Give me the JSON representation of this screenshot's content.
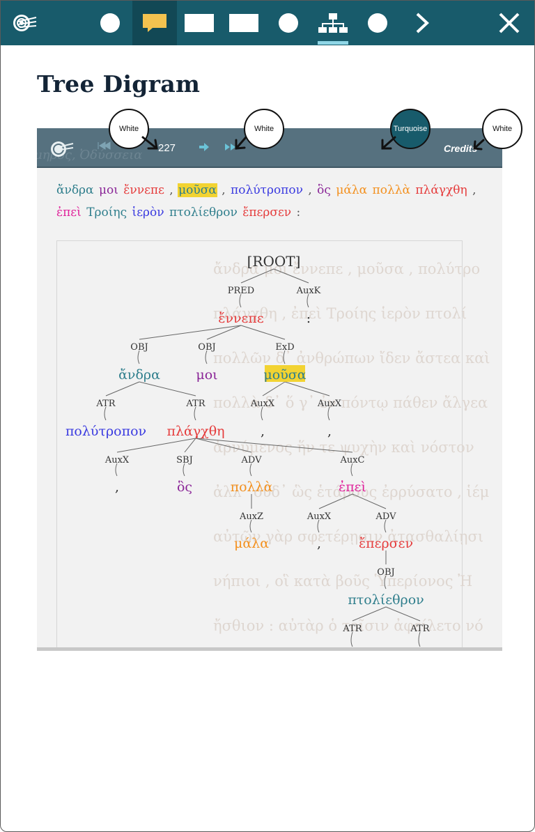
{
  "toolbar": {
    "items": [
      {
        "icon": "logo-icon"
      },
      {
        "icon": "circle-icon"
      },
      {
        "icon": "speech-bubble-icon"
      },
      {
        "icon": "rectangle-icon"
      },
      {
        "icon": "rectangle-icon"
      },
      {
        "icon": "circle-icon"
      },
      {
        "icon": "tree-diagram-icon"
      },
      {
        "icon": "circle-icon"
      },
      {
        "icon": "chevron-right-icon"
      },
      {
        "icon": "close-icon"
      }
    ],
    "colors": {
      "bar": "#185b6b",
      "active": "#124855",
      "accent": "#f4c24f"
    }
  },
  "page": {
    "title": "Tree Digram"
  },
  "screenshot": {
    "header": {
      "ghost_title": "μηρος, Ὀδύσσεια",
      "page_number": "227",
      "credits": "Credits"
    },
    "sentence": [
      {
        "text": "ἄνδρα",
        "color": "#2f7e8c"
      },
      {
        "text": "μοι",
        "color": "#8a2597"
      },
      {
        "text": "ἔννεπε",
        "color": "#e53b3b"
      },
      {
        "text": ",",
        "color": "#555555"
      },
      {
        "text": "μοῦσα",
        "color": "#2f7e8c",
        "highlight": true
      },
      {
        "text": ",",
        "color": "#555555"
      },
      {
        "text": "πολύτροπον",
        "color": "#3a3ae0"
      },
      {
        "text": ",",
        "color": "#555555"
      },
      {
        "text": "ὃς",
        "color": "#8a2597"
      },
      {
        "text": "μάλα",
        "color": "#f3901e"
      },
      {
        "text": "πολλὰ",
        "color": "#f3901e"
      },
      {
        "text": "πλάγχθη",
        "color": "#e53b3b"
      },
      {
        "text": ",",
        "color": "#555555"
      },
      {
        "text": "ἐπεὶ",
        "color": "#e0209a"
      },
      {
        "text": "Τροίης",
        "color": "#2f7e8c"
      },
      {
        "text": "ἱερὸν",
        "color": "#3a3ae0"
      },
      {
        "text": "πτολίεθρον",
        "color": "#2f7e8c"
      },
      {
        "text": "ἔπερσεν",
        "color": "#e53b3b"
      },
      {
        "text": ":",
        "color": "#555555"
      }
    ],
    "background_lines": [
      "ἄνδρα μοι ἔννεπε , μοῦσα , πολύτρο",
      "πλάγχθη , ἐπεὶ Τροίης ἱερὸν πτολί",
      "πολλῶν δ᾽ ἀνθρώπων ἴδεν ἄστεα καὶ",
      "πολλὰ δ᾽ ὅ γ᾽ ἐν πόντῳ πάθεν ἄλγεα",
      "ἀρνύμενος ἥν τε ψυχὴν καὶ νόστον",
      "ἀλλ᾽ οὐδ᾽ ὣς ἑτάρους ἐρρύσατο , ἱέμ",
      "αὐτῶν γὰρ σφετέρῃσιν ἀτασθαλίῃσι",
      "νήπιοι , οἳ κατὰ βοῦς Ὑπερίονος Ἠ",
      "ἤσθιον : αὐτὰρ ὁ τοῖσιν ἀφείλετο νό"
    ],
    "tree": {
      "root": "[ROOT]",
      "nodes": {
        "enn": {
          "word": "ἔννεπε",
          "color": "#e53b3b",
          "rel": "PRED"
        },
        "colon": {
          "word": ":",
          "color": "#333333",
          "rel": "AuxK"
        },
        "andra": {
          "word": "ἄνδρα",
          "color": "#2f7e8c",
          "rel": "OBJ"
        },
        "moi": {
          "word": "μοι",
          "color": "#8a2597",
          "rel": "OBJ"
        },
        "mousa": {
          "word": "μοῦσα",
          "color": "#2f7e8c",
          "rel": "ExD",
          "highlight": true
        },
        "poly": {
          "word": "πολύτροπον",
          "color": "#3a3ae0",
          "rel": "ATR"
        },
        "plag": {
          "word": "πλάγχθη",
          "color": "#e53b3b",
          "rel": "ATR"
        },
        "c1": {
          "word": ",",
          "color": "#333333",
          "rel": "AuxX"
        },
        "c2": {
          "word": ",",
          "color": "#333333",
          "rel": "AuxX"
        },
        "c3": {
          "word": ",",
          "color": "#333333",
          "rel": "AuxX"
        },
        "hos": {
          "word": "ὃς",
          "color": "#8a2597",
          "rel": "SBJ"
        },
        "polla": {
          "word": "πολλὰ",
          "color": "#f3901e",
          "rel": "ADV"
        },
        "epei": {
          "word": "ἐπεὶ",
          "color": "#e0209a",
          "rel": "AuxC"
        },
        "mala": {
          "word": "μάλα",
          "color": "#f3901e",
          "rel": "AuxZ"
        },
        "c4": {
          "word": ",",
          "color": "#333333",
          "rel": "AuxX"
        },
        "eper": {
          "word": "ἔπερσεν",
          "color": "#e53b3b",
          "rel": "ADV"
        },
        "ptol": {
          "word": "πτολίεθρον",
          "color": "#2f7e8c",
          "rel": "OBJ"
        },
        "atr1": {
          "word": "",
          "color": "#333333",
          "rel": "ATR"
        },
        "atr2": {
          "word": "",
          "color": "#333333",
          "rel": "ATR"
        }
      }
    }
  },
  "callouts": [
    {
      "label": "White"
    },
    {
      "label": "White"
    },
    {
      "label": "Turquoise",
      "color": "#185b6b"
    },
    {
      "label": "White"
    }
  ]
}
